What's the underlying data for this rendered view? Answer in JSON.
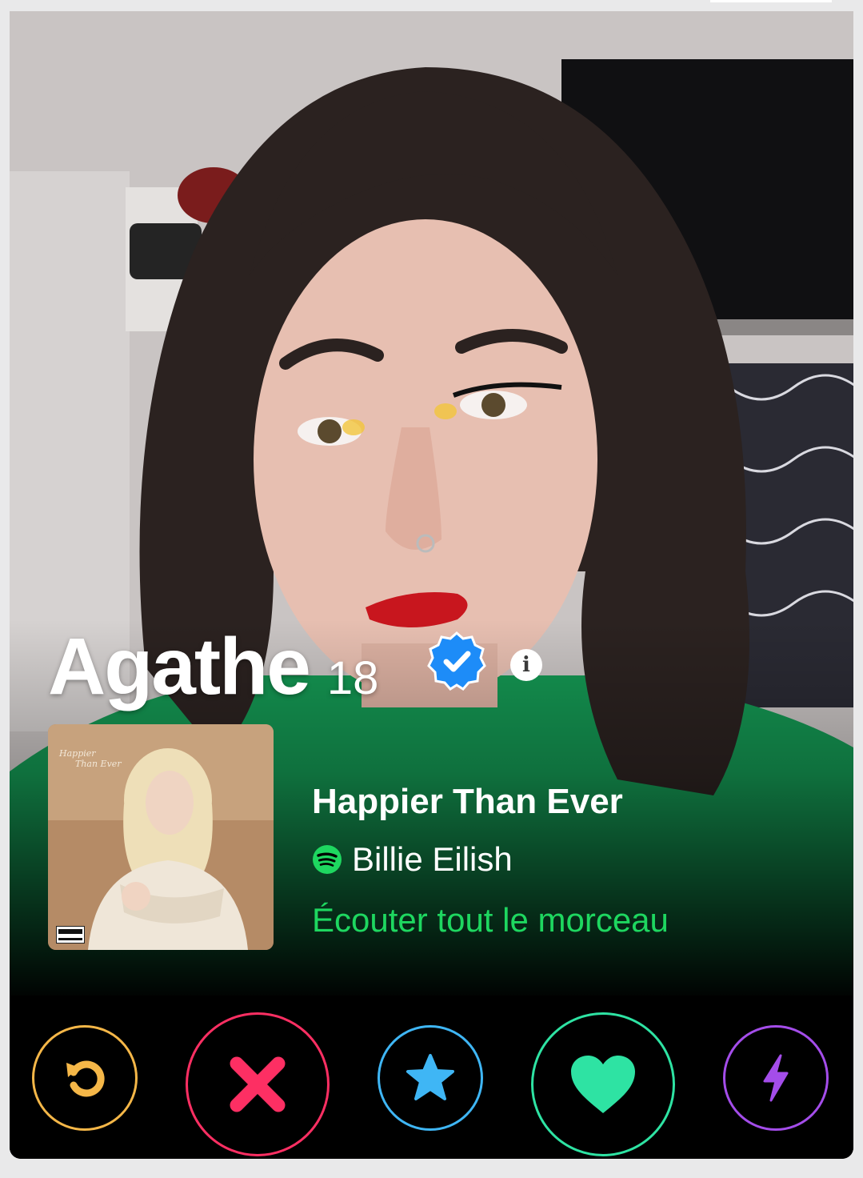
{
  "profile": {
    "name": "Agathe",
    "age": "18",
    "verified": true
  },
  "anthem": {
    "track_title": "Happier Than Ever",
    "artist": "Billie Eilish",
    "listen_label": "Écouter tout le morceau",
    "album_script_line1": "Happier",
    "album_script_line2": "Than Ever",
    "service_icon": "spotify-icon"
  },
  "actions": {
    "rewind_icon": "rewind-icon",
    "nope_icon": "close-icon",
    "super_like_icon": "star-icon",
    "like_icon": "heart-icon",
    "boost_icon": "lightning-icon"
  },
  "colors": {
    "rewind": "#f5b748",
    "nope": "#fd2f63",
    "super_like": "#3fb6f5",
    "like": "#2ee3a3",
    "boost": "#a44dea",
    "spotify": "#1ed760",
    "verified": "#1d8cf8"
  }
}
